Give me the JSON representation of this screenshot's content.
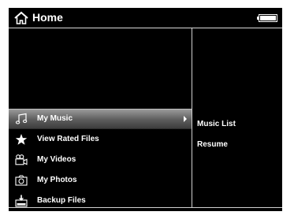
{
  "header": {
    "title": "Home",
    "home_icon": "home-icon",
    "battery_icon": "battery-icon"
  },
  "menu": {
    "items": [
      {
        "label": "My Music",
        "icon": "music-note-icon",
        "selected": true
      },
      {
        "label": "View Rated Files",
        "icon": "star-icon"
      },
      {
        "label": "My Videos",
        "icon": "video-camera-icon"
      },
      {
        "label": "My Photos",
        "icon": "camera-icon"
      },
      {
        "label": "Backup Files",
        "icon": "backup-icon"
      }
    ]
  },
  "submenu": {
    "items": [
      {
        "label": "Music List"
      },
      {
        "label": "Resume"
      }
    ]
  },
  "colors": {
    "background": "#000000",
    "text": "#ffffff",
    "selection": "#6a6a6a"
  }
}
